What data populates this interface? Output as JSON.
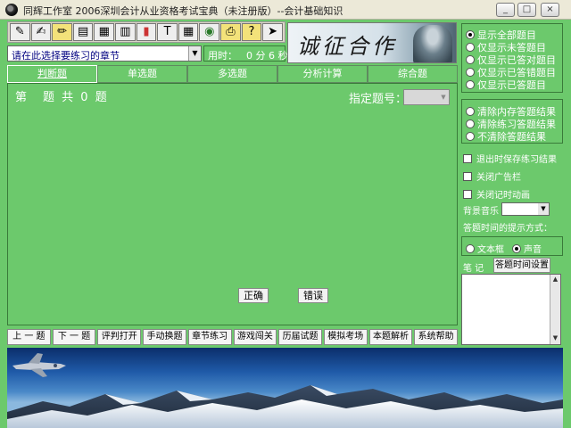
{
  "window": {
    "title": "同辉工作室 2006深圳会计从业资格考试宝典（未注册版）--会计基础知识",
    "min": "_",
    "max": "□",
    "close": "×"
  },
  "toolbar": {
    "icons": [
      "pen-icon",
      "edit-icon",
      "pencil-icon",
      "books-icon",
      "book-icon",
      "chart-icon",
      "color-icon",
      "text-icon",
      "table-icon",
      "globe-icon",
      "print-icon",
      "help-icon",
      "exit-icon"
    ]
  },
  "logo": {
    "text": "诚征合作"
  },
  "chapter": {
    "placeholder": "请在此选择要练习的章节"
  },
  "timer": {
    "label": "用时：",
    "value": "0 分 6 秒"
  },
  "tabs": [
    {
      "label": "判断题"
    },
    {
      "label": "单选题"
    },
    {
      "label": "多选题"
    },
    {
      "label": "分析计算"
    },
    {
      "label": "综合题"
    }
  ],
  "question": {
    "prefix": "第",
    "middle": "题 共",
    "count": "0",
    "suffix": "题",
    "assign_label": "指定题号："
  },
  "answer": {
    "correct": "正确",
    "wrong": "错误"
  },
  "nav": [
    {
      "label": "上 一 题"
    },
    {
      "label": "下 一 题"
    },
    {
      "label": "评判打开"
    },
    {
      "label": "手动换题"
    },
    {
      "label": "章节练习"
    },
    {
      "label": "游戏闯关"
    },
    {
      "label": "历届试题"
    },
    {
      "label": "模拟考场"
    },
    {
      "label": "本题解析"
    },
    {
      "label": "系统帮助"
    }
  ],
  "filter": {
    "options": [
      {
        "label": "显示全部题目",
        "selected": true
      },
      {
        "label": "仅显示未答题目",
        "selected": false
      },
      {
        "label": "仅显示已答对题目",
        "selected": false
      },
      {
        "label": "仅显示已答错题目",
        "selected": false
      },
      {
        "label": "仅显示已答题目",
        "selected": false
      }
    ]
  },
  "clear": {
    "options": [
      {
        "label": "清除内存答题结果"
      },
      {
        "label": "清除练习答题结果"
      },
      {
        "label": "不清除答题结果"
      }
    ]
  },
  "settings": {
    "save_on_exit": "退出时保存练习结果",
    "close_ads": "关闭广告栏",
    "close_timer_anim": "关闭记时动画",
    "music_label": "背景音乐",
    "hint_label": "答题时间的提示方式：",
    "hint_textbox": "文本框",
    "hint_sound": "声音",
    "note_label": "笔 记",
    "time_setting_button": "答题时间设置"
  }
}
